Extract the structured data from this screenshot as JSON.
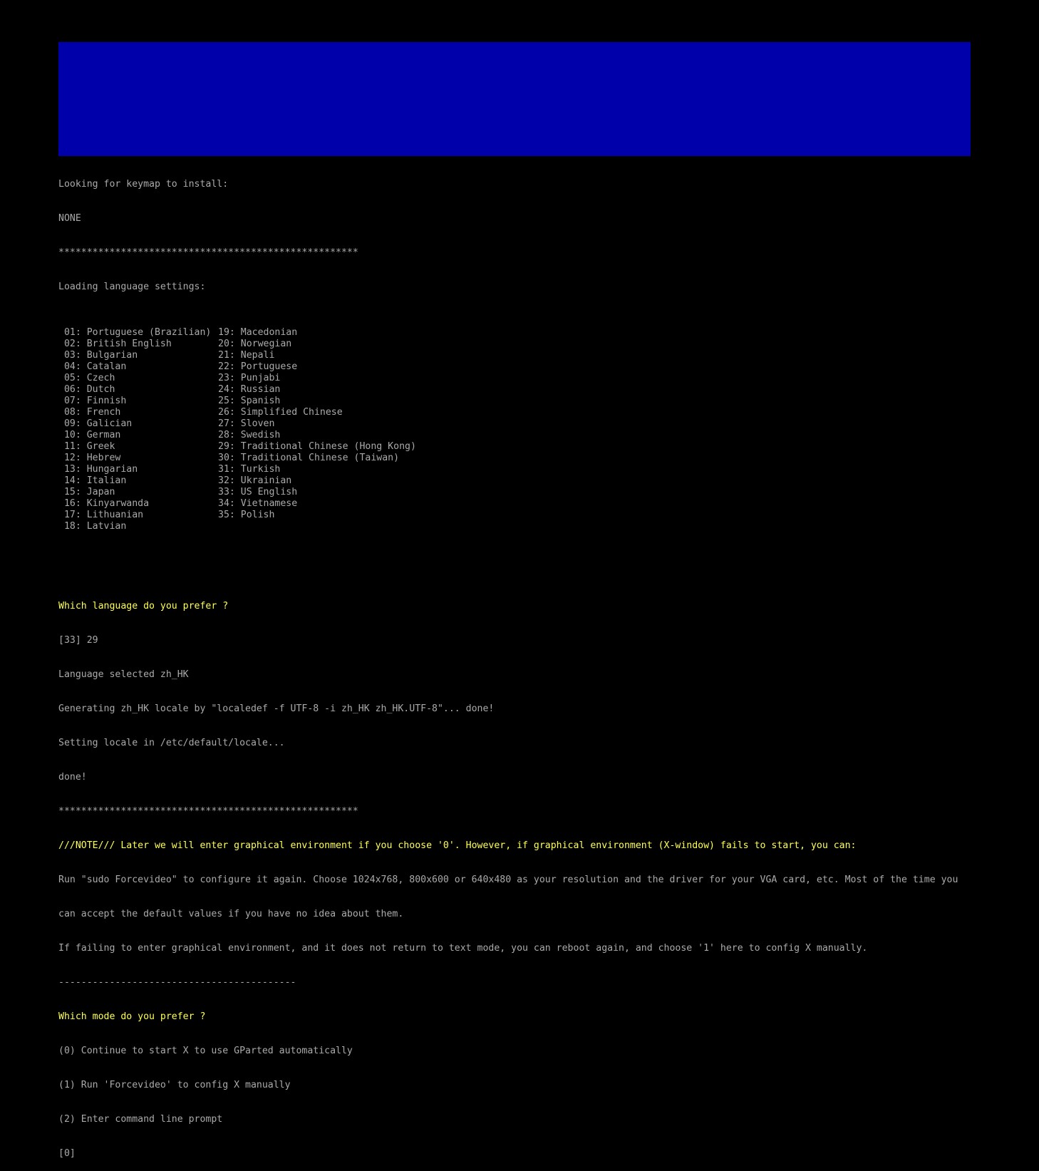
{
  "colors": {
    "background": "#000000",
    "banner": "#0000aa",
    "text": "#aaaaaa",
    "highlight": "#ffff55"
  },
  "keymap": {
    "heading": "Looking for keymap to install:",
    "value": "NONE"
  },
  "separator": "*****************************************************",
  "languages": {
    "heading": "Loading language settings:",
    "left_column": [
      " 01: Portuguese (Brazilian)",
      " 02: British English",
      " 03: Bulgarian",
      " 04: Catalan",
      " 05: Czech",
      " 06: Dutch",
      " 07: Finnish",
      " 08: French",
      " 09: Galician",
      " 10: German",
      " 11: Greek",
      " 12: Hebrew",
      " 13: Hungarian",
      " 14: Italian",
      " 15: Japan",
      " 16: Kinyarwanda",
      " 17: Lithuanian",
      " 18: Latvian"
    ],
    "right_column": [
      "19: Macedonian",
      "20: Norwegian",
      "21: Nepali",
      "22: Portuguese",
      "23: Punjabi",
      "24: Russian",
      "25: Spanish",
      "26: Simplified Chinese",
      "27: Sloven",
      "28: Swedish",
      "29: Traditional Chinese (Hong Kong)",
      "30: Traditional Chinese (Taiwan)",
      "31: Turkish",
      "32: Ukrainian",
      "33: US English",
      "34: Vietnamese",
      "35: Polish",
      ""
    ]
  },
  "language_prompt": {
    "question": "Which language do you prefer ?",
    "answer": "[33] 29",
    "selected": "Language selected zh_HK",
    "generating": "Generating zh_HK locale by \"localedef -f UTF-8 -i zh_HK zh_HK.UTF-8\"... done!",
    "setting": "Setting locale in /etc/default/locale...",
    "done": "done!"
  },
  "note": {
    "headline": "///NOTE/// Later we will enter graphical environment if you choose '0'. However, if graphical environment (X-window) fails to start, you can:",
    "line1": "Run \"sudo Forcevideo\" to configure it again. Choose 1024x768, 800x600 or 640x480 as your resolution and the driver for your VGA card, etc. Most of the time you",
    "line2": "can accept the default values if you have no idea about them.",
    "line3": "If failing to enter graphical environment, and it does not return to text mode, you can reboot again, and choose '1' here to config X manually.",
    "divider": "------------------------------------------"
  },
  "mode_prompt": {
    "question": "Which mode do you prefer ?",
    "options": [
      "(0) Continue to start X to use GParted automatically",
      "(1) Run 'Forcevideo' to config X manually",
      "(2) Enter command line prompt"
    ],
    "input_default": "[0]"
  }
}
